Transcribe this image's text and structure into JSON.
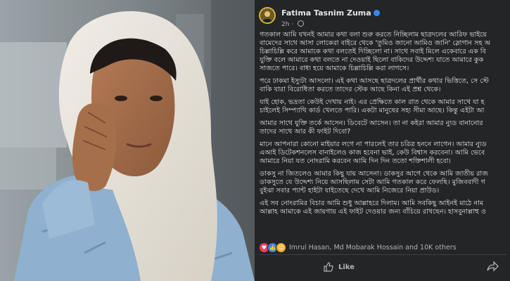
{
  "post": {
    "author": "Fatima Tasnim Zuma",
    "time": "2h",
    "paragraphs": [
      [
        "গতকাল আমি যখনই আমার কথা বলা শুরু করতে নিচ্ছিলাম ছাত্রদলের আরিফ ভাইয়ে",
        "বামেদের সাথে আসা লোকেরা বাইরে থেকে 'তুমিও জানো আমিও জানি' স্লোগান সহ অ",
        "চিল্লাচিল্লি করে আমাকে কথা বলতেই দিচ্ছিলো না। সাথে সবাই মিলে একেবারে এক বি",
        "যুক্তি বলে আমারে কথা বলতে না দেওয়াই ছিলো বাকিদের উদ্দেশ্য যাতে আমারে কুক",
        "সাজতে পারে। বাধ্য হয়ে আমাকে চিল্লাচিল্লি করা লাগসে।"
      ],
      [
        "পরে ঢাকমা ইস্যুটা আসলো। এই কথা আসছে ছাত্রদলের প্রার্থীর কথার ভিত্তিতে, সে স্টে",
        "বাকি যারা বিরোধিতা করতে তাদের স্টেক আছে কিনা এই প্রশ্ন থেকে।"
      ],
      [
        "যাই হোক, ভদ্রতা কেউই দেখায় নাই। এর প্রেক্ষিতে কাল রাত থেকে আমার সাথে যা হ",
        "চাইলেই সিম্প্যাথি কার্ড খেলতে পারি। একটা মানুষের সহ্য সীমা আছে। কিন্তু এইটা আ"
      ],
      [
        "আমার সাথে যুক্তি তর্কে আসেন। ডিবেটে আসেন। তা না কইরা আমার ন্যুড বানানোর",
        "তাদের সাথে আর কী ফাইট দিবো?"
      ],
      [
        "মানে আপনারা কোনো মাইয়ার লগে না পারলেই তার চরিত্র হননে লাগেন। আমার ন্যুড",
        "এআই ডিটেকশনলেস বানাইলেও কাজ হবেনা ভাই, কেউ বিশ্বাস করবেনা। আমি ভেবে",
        "আমারে নিয়া যত নোংরামি করবেন আমি দিন দিন ততো শক্তিশালী হবো।"
      ],
      [
        "ডাকসু না জিতলেও আমার কিছু যায় আসেনা। ডাকসুর আগে থেকে আমি জাতীয় রাজ",
        "ডাকসুতে যে উদ্দেশ্য নিয়ে আসছিলাম সেটা আমি গতকাল করে ফেলছি। মুজিববাদী গ",
        "বুইঝা সবার প্যান্ট হাইটা যাইতেছে দেখে আমি নিজেরে নিয়া প্রাউড।"
      ],
      [
        "এই সব নোংরামির বিচার আমি শুধু আল্লাহরে দিলাম। আমি সবকিছু আইনই মাঠে নাম",
        "আল্লাহ আমাকে এই জায়গায় এই ফাইট দেওয়ার জন্য বাঁচিয়ে রাখছেন। হাসবুনাল্লাহু ও"
      ]
    ]
  },
  "reactions": {
    "summary": "Imrul Hasan, Md Mobarak Hossain and 10K others"
  },
  "actions": {
    "like_label": "Like"
  }
}
